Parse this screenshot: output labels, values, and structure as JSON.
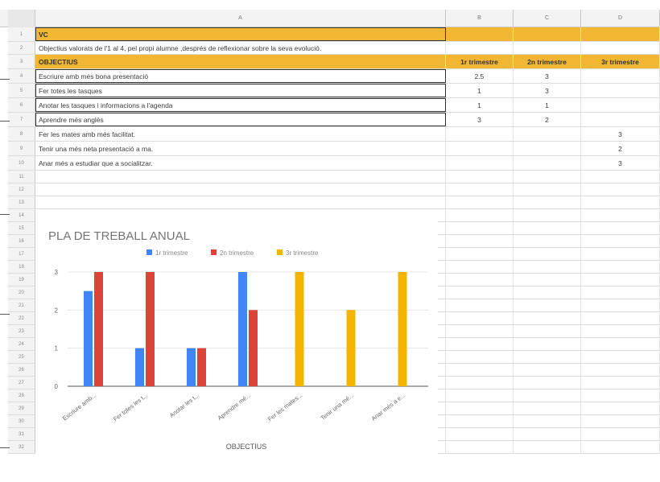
{
  "columns": [
    "A",
    "B",
    "C",
    "D"
  ],
  "rows": [
    {
      "num": "1",
      "a": "VC",
      "b": "",
      "c": "",
      "d": ""
    },
    {
      "num": "2",
      "a": "Objectius valorats de l'1 al 4, pel propi alumne ,després de reflexionar sobre la seva evolució.",
      "b": "",
      "c": "",
      "d": ""
    },
    {
      "num": "3",
      "a": "OBJECTIUS",
      "b": "1r trimestre",
      "c": "2n trimestre",
      "d": "3r trimestre"
    },
    {
      "num": "4",
      "a": "Escriure amb més bona presentació",
      "b": "2.5",
      "c": "3",
      "d": ""
    },
    {
      "num": "5",
      "a": "Fer totes les tasques",
      "b": "1",
      "c": "3",
      "d": ""
    },
    {
      "num": "6",
      "a": "Anotar les tasques i informacions a l'agenda",
      "b": "1",
      "c": "1",
      "d": ""
    },
    {
      "num": "7",
      "a": "Aprendre més anglès",
      "b": "3",
      "c": "2",
      "d": ""
    },
    {
      "num": "8",
      "a": "Fer les mates amb més facilitat.",
      "b": "",
      "c": "",
      "d": "3"
    },
    {
      "num": "9",
      "a": "Tenir una més neta presentació a ma.",
      "b": "",
      "c": "",
      "d": "2"
    },
    {
      "num": "10",
      "a": "Anar més a estudiar que a socialitzar.",
      "b": "",
      "c": "",
      "d": "3"
    },
    {
      "num": "11",
      "a": "",
      "b": "",
      "c": "",
      "d": ""
    },
    {
      "num": "12",
      "a": "",
      "b": "",
      "c": "",
      "d": ""
    },
    {
      "num": "13",
      "a": "",
      "b": "",
      "c": "",
      "d": ""
    },
    {
      "num": "14",
      "a": "",
      "b": "",
      "c": "",
      "d": ""
    },
    {
      "num": "15",
      "a": "",
      "b": "",
      "c": "",
      "d": ""
    },
    {
      "num": "16",
      "a": "",
      "b": "",
      "c": "",
      "d": ""
    },
    {
      "num": "17",
      "a": "",
      "b": "",
      "c": "",
      "d": ""
    },
    {
      "num": "18",
      "a": "",
      "b": "",
      "c": "",
      "d": ""
    },
    {
      "num": "19",
      "a": "",
      "b": "",
      "c": "",
      "d": ""
    },
    {
      "num": "20",
      "a": "",
      "b": "",
      "c": "",
      "d": ""
    },
    {
      "num": "21",
      "a": "",
      "b": "",
      "c": "",
      "d": ""
    },
    {
      "num": "22",
      "a": "",
      "b": "",
      "c": "",
      "d": ""
    },
    {
      "num": "23",
      "a": "",
      "b": "",
      "c": "",
      "d": ""
    },
    {
      "num": "24",
      "a": "",
      "b": "",
      "c": "",
      "d": ""
    },
    {
      "num": "25",
      "a": "",
      "b": "",
      "c": "",
      "d": ""
    },
    {
      "num": "26",
      "a": "",
      "b": "",
      "c": "",
      "d": ""
    },
    {
      "num": "27",
      "a": "",
      "b": "",
      "c": "",
      "d": ""
    },
    {
      "num": "28",
      "a": "",
      "b": "",
      "c": "",
      "d": ""
    },
    {
      "num": "29",
      "a": "",
      "b": "",
      "c": "",
      "d": ""
    },
    {
      "num": "30",
      "a": "",
      "b": "",
      "c": "",
      "d": ""
    },
    {
      "num": "31",
      "a": "",
      "b": "",
      "c": "",
      "d": ""
    },
    {
      "num": "32",
      "a": "",
      "b": "",
      "c": "",
      "d": ""
    }
  ],
  "colors": {
    "header_fill": "#f1b733",
    "series_1": "#4285f4",
    "series_2": "#db4437",
    "series_3": "#f4b400"
  },
  "chart_data": {
    "type": "bar",
    "title": "PLA DE TREBALL ANUAL",
    "xlabel": "OBJECTIUS",
    "ylabel": "",
    "ylim": [
      0,
      3
    ],
    "yticks": [
      "0",
      "1",
      "2",
      "3"
    ],
    "legend_position": "top",
    "grid": true,
    "categories": [
      "Escriure amb...",
      "Fer totes les t...",
      "Anotar les t...",
      "Aprendre mé...",
      "Fer les mates...",
      "Tenir una mé...",
      "Anar més a e..."
    ],
    "series": [
      {
        "name": "1r trimestre",
        "color": "#4285f4",
        "values": [
          2.5,
          1,
          1,
          3,
          null,
          null,
          null
        ]
      },
      {
        "name": "2n trimestre",
        "color": "#db4437",
        "values": [
          3,
          3,
          1,
          2,
          null,
          null,
          null
        ]
      },
      {
        "name": "3r trimestre",
        "color": "#f4b400",
        "values": [
          null,
          null,
          null,
          null,
          3,
          2,
          3
        ]
      }
    ]
  }
}
